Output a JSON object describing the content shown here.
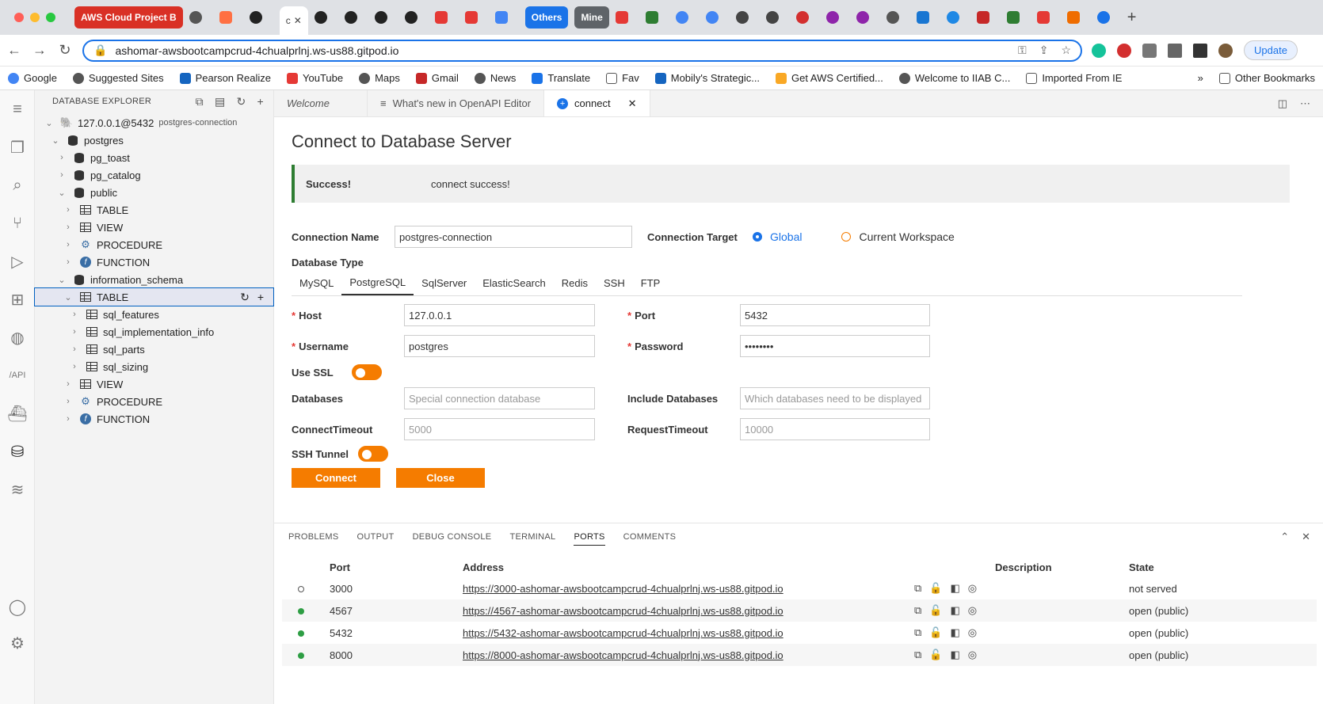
{
  "browser": {
    "tabs": {
      "group_aws": "AWS Cloud Project B",
      "group_others": "Others",
      "group_mine": "Mine",
      "active_short": "c"
    },
    "url": "ashomar-awsbootcampcrud-4chualprlnj.ws-us88.gitpod.io",
    "update_label": "Update",
    "bookmarks": [
      "Google",
      "Suggested Sites",
      "Pearson Realize",
      "YouTube",
      "Maps",
      "Gmail",
      "News",
      "Translate",
      "Fav",
      "Mobily's Strategic...",
      "Get AWS Certified...",
      "Welcome to IIAB C...",
      "Imported From IE",
      "Other Bookmarks"
    ]
  },
  "sidebar": {
    "title": "DATABASE EXPLORER",
    "tree": [
      {
        "label": "127.0.0.1@5432",
        "sub": "postgres-connection"
      },
      {
        "label": "postgres"
      },
      {
        "label": "pg_toast"
      },
      {
        "label": "pg_catalog"
      },
      {
        "label": "public"
      },
      {
        "label": "TABLE"
      },
      {
        "label": "VIEW"
      },
      {
        "label": "PROCEDURE"
      },
      {
        "label": "FUNCTION"
      },
      {
        "label": "information_schema"
      },
      {
        "label": "TABLE"
      },
      {
        "label": "sql_features"
      },
      {
        "label": "sql_implementation_info"
      },
      {
        "label": "sql_parts"
      },
      {
        "label": "sql_sizing"
      },
      {
        "label": "VIEW"
      },
      {
        "label": "PROCEDURE"
      },
      {
        "label": "FUNCTION"
      }
    ]
  },
  "editor": {
    "tabs": [
      "Welcome",
      "What's new in OpenAPI Editor",
      "connect"
    ],
    "title": "Connect to Database Server",
    "alert": {
      "label": "Success!",
      "message": "connect success!"
    },
    "connection_name_label": "Connection Name",
    "connection_name_value": "postgres-connection",
    "connection_target_label": "Connection Target",
    "target_global": "Global",
    "target_workspace": "Current Workspace",
    "db_type_label": "Database Type",
    "db_types": [
      "MySQL",
      "PostgreSQL",
      "SqlServer",
      "ElasticSearch",
      "Redis",
      "SSH",
      "FTP"
    ],
    "host_label": "Host",
    "host_value": "127.0.0.1",
    "port_label": "Port",
    "port_value": "5432",
    "username_label": "Username",
    "username_value": "postgres",
    "password_label": "Password",
    "password_value": "••••••••",
    "use_ssl_label": "Use SSL",
    "databases_label": "Databases",
    "databases_placeholder": "Special connection database",
    "include_db_label": "Include Databases",
    "include_db_placeholder": "Which databases need to be displayed",
    "connect_timeout_label": "ConnectTimeout",
    "connect_timeout_placeholder": "5000",
    "request_timeout_label": "RequestTimeout",
    "request_timeout_placeholder": "10000",
    "ssh_tunnel_label": "SSH Tunnel",
    "connect_button": "Connect",
    "close_button": "Close"
  },
  "panel": {
    "tabs": [
      "PROBLEMS",
      "OUTPUT",
      "DEBUG CONSOLE",
      "TERMINAL",
      "PORTS",
      "COMMENTS"
    ],
    "columns": [
      "Port",
      "Address",
      "Description",
      "State"
    ],
    "rows": [
      {
        "port": "3000",
        "address": "https://3000-ashomar-awsbootcampcrud-4chualprlnj.ws-us88.gitpod.io",
        "state": "not served",
        "dot": "#ffffff"
      },
      {
        "port": "4567",
        "address": "https://4567-ashomar-awsbootcampcrud-4chualprlnj.ws-us88.gitpod.io",
        "state": "open (public)",
        "dot": "#2e9e44"
      },
      {
        "port": "5432",
        "address": "https://5432-ashomar-awsbootcampcrud-4chualprlnj.ws-us88.gitpod.io",
        "state": "open (public)",
        "dot": "#2e9e44"
      },
      {
        "port": "8000",
        "address": "https://8000-ashomar-awsbootcampcrud-4chualprlnj.ws-us88.gitpod.io",
        "state": "open (public)",
        "dot": "#2e9e44"
      }
    ]
  },
  "colors": {
    "accent": "#f57c00",
    "link": "#1a73e8",
    "success": "#2e7d32"
  }
}
